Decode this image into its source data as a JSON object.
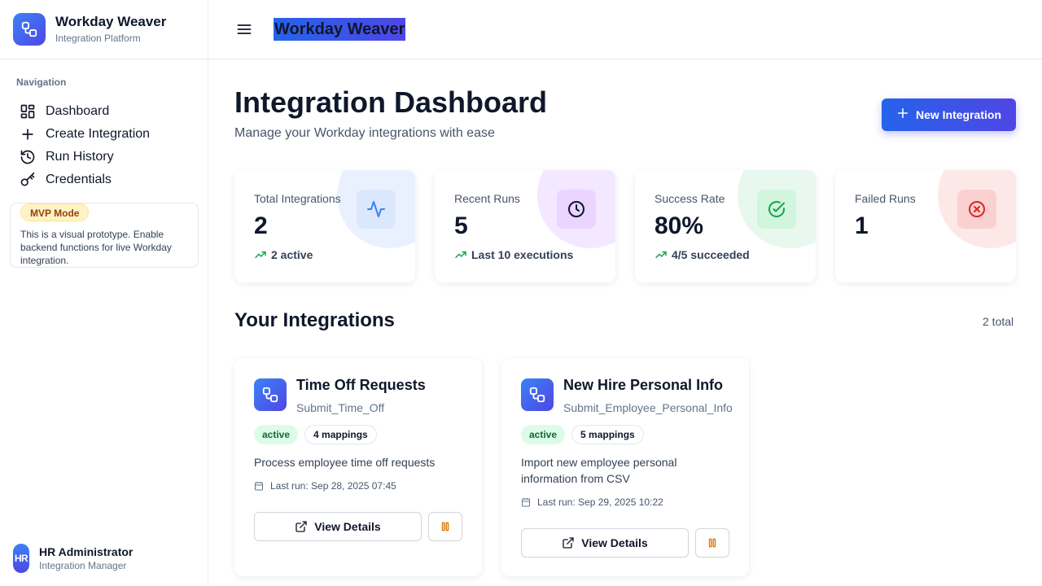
{
  "brand": {
    "title": "Workday Weaver",
    "subtitle": "Integration Platform"
  },
  "sidebar": {
    "heading": "Navigation",
    "items": [
      {
        "label": "Dashboard",
        "icon": "grid-icon"
      },
      {
        "label": "Create Integration",
        "icon": "plus-icon"
      },
      {
        "label": "Run History",
        "icon": "history-icon"
      },
      {
        "label": "Credentials",
        "icon": "key-icon"
      }
    ],
    "mvp": {
      "badge": "MVP Mode",
      "text": "This is a visual prototype. Enable backend functions for live Workday integration."
    },
    "user": {
      "initials": "HR",
      "name": "HR Administrator",
      "role": "Integration Manager"
    }
  },
  "header": {
    "title": "Workday Weaver"
  },
  "main": {
    "title": "Integration Dashboard",
    "subtitle": "Manage your Workday integrations with ease",
    "new_button": "New Integration",
    "stats": [
      {
        "label": "Total Integrations",
        "value": "2",
        "trend": "2 active",
        "icon": "activity-icon",
        "color": "#3b82f6"
      },
      {
        "label": "Recent Runs",
        "value": "5",
        "trend": "Last 10 executions",
        "icon": "clock-icon",
        "color": "#a855f7"
      },
      {
        "label": "Success Rate",
        "value": "80%",
        "trend": "4/5 succeeded",
        "icon": "check-circle-icon",
        "color": "#22c55e"
      },
      {
        "label": "Failed Runs",
        "value": "1",
        "trend": "",
        "icon": "x-circle-icon",
        "color": "#ef4444"
      }
    ],
    "section_title": "Your Integrations",
    "section_count": "2 total",
    "integrations": [
      {
        "name": "Time Off Requests",
        "operation": "Submit_Time_Off",
        "status": "active",
        "mappings": "4 mappings",
        "description": "Process employee time off requests",
        "last_run": "Last run: Sep 28, 2025 07:45",
        "view_label": "View Details"
      },
      {
        "name": "New Hire Personal Info",
        "operation": "Submit_Employee_Personal_Info",
        "status": "active",
        "mappings": "5 mappings",
        "description": "Import new employee personal information from CSV",
        "last_run": "Last run: Sep 29, 2025 10:22",
        "view_label": "View Details"
      }
    ]
  },
  "colors": {
    "accent": "#4f46e5",
    "accent_blue": "#2563eb",
    "success": "#16a34a",
    "warning": "#d97706"
  }
}
